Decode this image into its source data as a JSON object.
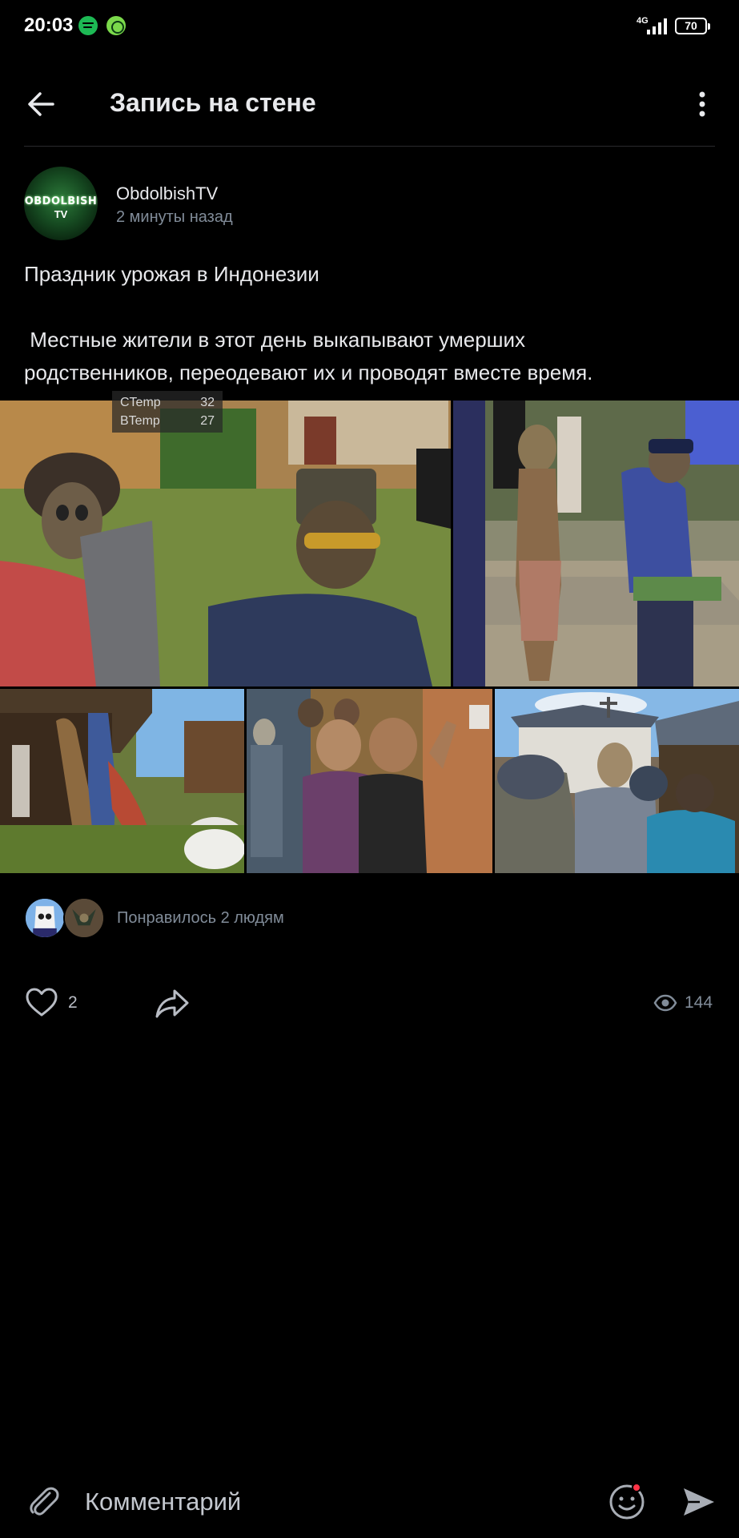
{
  "status_bar": {
    "time": "20:03",
    "network": "4G",
    "battery": "70",
    "apps": [
      "spotify-icon",
      "shield-icon"
    ]
  },
  "header": {
    "title": "Запись на стене",
    "back_icon": "arrow-left-icon",
    "more_icon": "more-vertical-icon"
  },
  "post": {
    "author": {
      "name": "ObdolbishTV",
      "avatar_text": "OBDOLBISH",
      "avatar_subtext": "TV"
    },
    "time": "2 минуты назад",
    "text": {
      "line1": "Праздник урожая в Индонезии",
      "line2": " Местные жители в этот день выкапывают умерших",
      "line3": "родственников, переодевают их и проводят вместе время."
    },
    "photos": [
      "photo-1",
      "photo-2",
      "photo-3",
      "photo-4",
      "photo-5"
    ],
    "overlay": {
      "ctemp_label": "CTemp",
      "ctemp_value": "32",
      "btemp_label": "BTemp",
      "btemp_value": "27"
    },
    "likes_summary": "Понравилось 2 людям",
    "like_count": "2",
    "views": "144"
  },
  "comment_bar": {
    "placeholder": "Комментарий"
  },
  "colors": {
    "background": "#000000",
    "text": "#e8e9ec",
    "secondary": "#818c99",
    "divider": "#2a2b2e",
    "notification": "#ff3347"
  }
}
